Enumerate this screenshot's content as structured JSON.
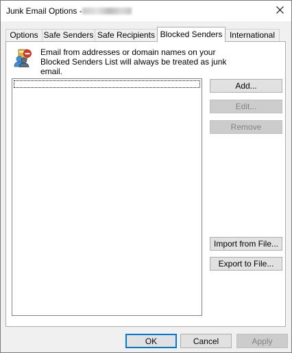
{
  "window": {
    "title": "Junk Email Options - ",
    "close_glyph": "✕"
  },
  "tabs": [
    {
      "label": "Options"
    },
    {
      "label": "Safe Senders"
    },
    {
      "label": "Safe Recipients"
    },
    {
      "label": "Blocked Senders",
      "active": true
    },
    {
      "label": "International"
    }
  ],
  "info": {
    "icon": "blocked-senders-icon",
    "text": "Email from addresses or domain names on your Blocked Senders List will always be treated as junk email."
  },
  "blocked_list": {
    "items": []
  },
  "side_buttons": {
    "add": "Add...",
    "edit": "Edit...",
    "remove": "Remove",
    "import": "Import from File...",
    "export": "Export to File..."
  },
  "footer": {
    "ok": "OK",
    "cancel": "Cancel",
    "apply": "Apply"
  },
  "colors": {
    "default_button_border": "#0078d7",
    "disabled_button_bg": "#cccccc"
  }
}
